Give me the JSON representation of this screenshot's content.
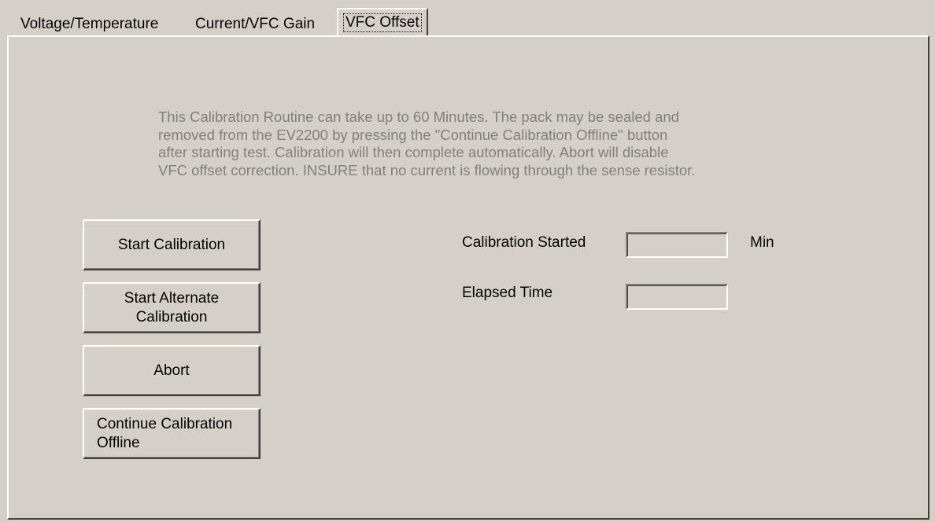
{
  "tabs": [
    {
      "label": "Voltage/Temperature",
      "active": false
    },
    {
      "label": "Current/VFC Gain",
      "active": false
    },
    {
      "label": "VFC Offset",
      "active": true
    }
  ],
  "description": [
    "This Calibration Routine can take up to 60 Minutes. The pack may be sealed and",
    "removed from the EV2200 by pressing the \"Continue Calibration Offline\" button",
    "after starting test.  Calibration will then complete automatically. Abort will disable",
    "VFC offset correction. INSURE that no current is flowing through the sense resistor."
  ],
  "buttons": {
    "start_calibration": "Start Calibration",
    "start_alternate_line1": "Start Alternate",
    "start_alternate_line2": "Calibration",
    "abort": "Abort",
    "continue_offline_line1": "Continue Calibration",
    "continue_offline_line2": "Offline"
  },
  "fields": {
    "calibration_started_label": "Calibration Started",
    "calibration_started_value": "",
    "calibration_started_unit": "Min",
    "elapsed_time_label": "Elapsed Time",
    "elapsed_time_value": ""
  },
  "colors": {
    "face": "#d4d0c8",
    "disabled_text": "#808080"
  }
}
